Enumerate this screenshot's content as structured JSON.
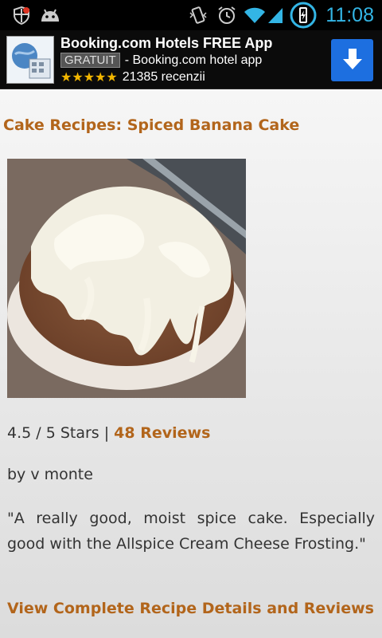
{
  "status_bar": {
    "time": "11:08",
    "icons": [
      "shield-icon",
      "android-icon",
      "vibrate-icon",
      "alarm-icon",
      "wifi-icon",
      "signal-icon",
      "battery-charging-icon"
    ]
  },
  "ad": {
    "title": "Booking.com Hotels FREE App",
    "badge": "GRATUIT",
    "subtitle": "- Booking.com hotel app",
    "stars": "★★★★★",
    "rating_value": 4.5,
    "reviews": "21385 recenzii",
    "download_icon": "download-arrow-icon",
    "colors": {
      "download_bg": "#1d6fe0",
      "stars": "#f2b600"
    }
  },
  "recipe": {
    "title": "Cake Recipes: Spiced Banana Cake",
    "rating_text": "4.5 / 5 Stars | ",
    "reviews_link": "48 Reviews",
    "author": "by v monte",
    "quote": "\"A really good, moist spice cake. Especially good with the Allspice Cream Cheese Frosting.\"",
    "view_link": "View Complete Recipe Details and Reviews",
    "colors": {
      "link": "#b2651b",
      "text": "#333333"
    }
  }
}
